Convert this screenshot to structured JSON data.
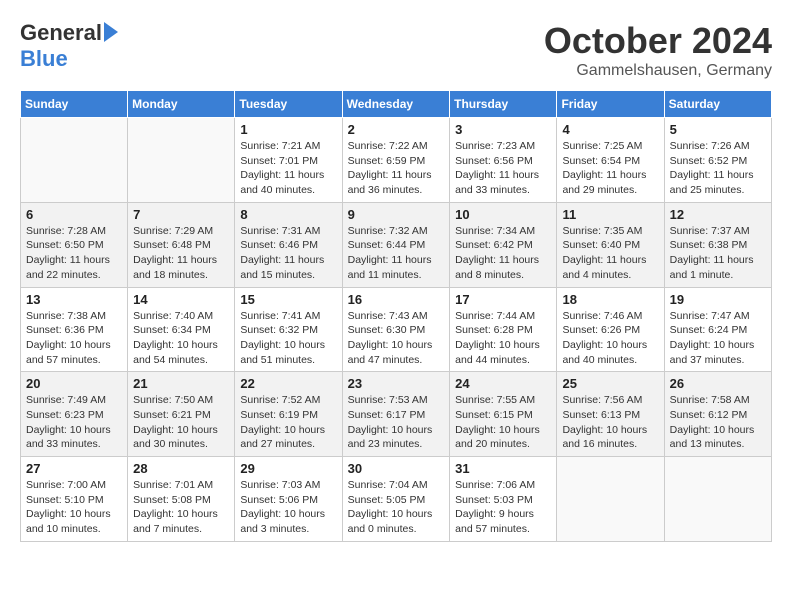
{
  "header": {
    "logo_general": "General",
    "logo_blue": "Blue",
    "month_title": "October 2024",
    "subtitle": "Gammelshausen, Germany"
  },
  "weekdays": [
    "Sunday",
    "Monday",
    "Tuesday",
    "Wednesday",
    "Thursday",
    "Friday",
    "Saturday"
  ],
  "weeks": [
    [
      {
        "day": "",
        "info": ""
      },
      {
        "day": "",
        "info": ""
      },
      {
        "day": "1",
        "info": "Sunrise: 7:21 AM\nSunset: 7:01 PM\nDaylight: 11 hours and 40 minutes."
      },
      {
        "day": "2",
        "info": "Sunrise: 7:22 AM\nSunset: 6:59 PM\nDaylight: 11 hours and 36 minutes."
      },
      {
        "day": "3",
        "info": "Sunrise: 7:23 AM\nSunset: 6:56 PM\nDaylight: 11 hours and 33 minutes."
      },
      {
        "day": "4",
        "info": "Sunrise: 7:25 AM\nSunset: 6:54 PM\nDaylight: 11 hours and 29 minutes."
      },
      {
        "day": "5",
        "info": "Sunrise: 7:26 AM\nSunset: 6:52 PM\nDaylight: 11 hours and 25 minutes."
      }
    ],
    [
      {
        "day": "6",
        "info": "Sunrise: 7:28 AM\nSunset: 6:50 PM\nDaylight: 11 hours and 22 minutes."
      },
      {
        "day": "7",
        "info": "Sunrise: 7:29 AM\nSunset: 6:48 PM\nDaylight: 11 hours and 18 minutes."
      },
      {
        "day": "8",
        "info": "Sunrise: 7:31 AM\nSunset: 6:46 PM\nDaylight: 11 hours and 15 minutes."
      },
      {
        "day": "9",
        "info": "Sunrise: 7:32 AM\nSunset: 6:44 PM\nDaylight: 11 hours and 11 minutes."
      },
      {
        "day": "10",
        "info": "Sunrise: 7:34 AM\nSunset: 6:42 PM\nDaylight: 11 hours and 8 minutes."
      },
      {
        "day": "11",
        "info": "Sunrise: 7:35 AM\nSunset: 6:40 PM\nDaylight: 11 hours and 4 minutes."
      },
      {
        "day": "12",
        "info": "Sunrise: 7:37 AM\nSunset: 6:38 PM\nDaylight: 11 hours and 1 minute."
      }
    ],
    [
      {
        "day": "13",
        "info": "Sunrise: 7:38 AM\nSunset: 6:36 PM\nDaylight: 10 hours and 57 minutes."
      },
      {
        "day": "14",
        "info": "Sunrise: 7:40 AM\nSunset: 6:34 PM\nDaylight: 10 hours and 54 minutes."
      },
      {
        "day": "15",
        "info": "Sunrise: 7:41 AM\nSunset: 6:32 PM\nDaylight: 10 hours and 51 minutes."
      },
      {
        "day": "16",
        "info": "Sunrise: 7:43 AM\nSunset: 6:30 PM\nDaylight: 10 hours and 47 minutes."
      },
      {
        "day": "17",
        "info": "Sunrise: 7:44 AM\nSunset: 6:28 PM\nDaylight: 10 hours and 44 minutes."
      },
      {
        "day": "18",
        "info": "Sunrise: 7:46 AM\nSunset: 6:26 PM\nDaylight: 10 hours and 40 minutes."
      },
      {
        "day": "19",
        "info": "Sunrise: 7:47 AM\nSunset: 6:24 PM\nDaylight: 10 hours and 37 minutes."
      }
    ],
    [
      {
        "day": "20",
        "info": "Sunrise: 7:49 AM\nSunset: 6:23 PM\nDaylight: 10 hours and 33 minutes."
      },
      {
        "day": "21",
        "info": "Sunrise: 7:50 AM\nSunset: 6:21 PM\nDaylight: 10 hours and 30 minutes."
      },
      {
        "day": "22",
        "info": "Sunrise: 7:52 AM\nSunset: 6:19 PM\nDaylight: 10 hours and 27 minutes."
      },
      {
        "day": "23",
        "info": "Sunrise: 7:53 AM\nSunset: 6:17 PM\nDaylight: 10 hours and 23 minutes."
      },
      {
        "day": "24",
        "info": "Sunrise: 7:55 AM\nSunset: 6:15 PM\nDaylight: 10 hours and 20 minutes."
      },
      {
        "day": "25",
        "info": "Sunrise: 7:56 AM\nSunset: 6:13 PM\nDaylight: 10 hours and 16 minutes."
      },
      {
        "day": "26",
        "info": "Sunrise: 7:58 AM\nSunset: 6:12 PM\nDaylight: 10 hours and 13 minutes."
      }
    ],
    [
      {
        "day": "27",
        "info": "Sunrise: 7:00 AM\nSunset: 5:10 PM\nDaylight: 10 hours and 10 minutes."
      },
      {
        "day": "28",
        "info": "Sunrise: 7:01 AM\nSunset: 5:08 PM\nDaylight: 10 hours and 7 minutes."
      },
      {
        "day": "29",
        "info": "Sunrise: 7:03 AM\nSunset: 5:06 PM\nDaylight: 10 hours and 3 minutes."
      },
      {
        "day": "30",
        "info": "Sunrise: 7:04 AM\nSunset: 5:05 PM\nDaylight: 10 hours and 0 minutes."
      },
      {
        "day": "31",
        "info": "Sunrise: 7:06 AM\nSunset: 5:03 PM\nDaylight: 9 hours and 57 minutes."
      },
      {
        "day": "",
        "info": ""
      },
      {
        "day": "",
        "info": ""
      }
    ]
  ]
}
